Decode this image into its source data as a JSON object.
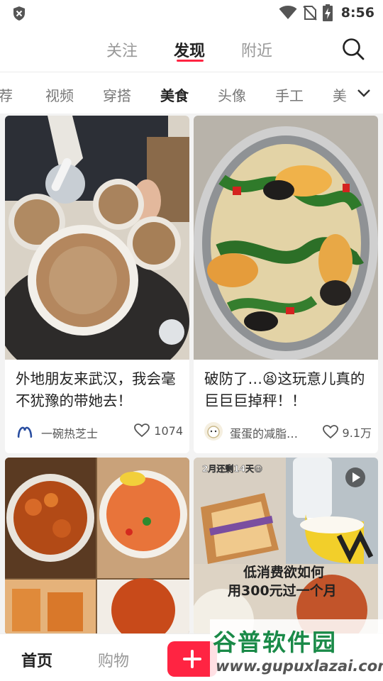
{
  "status_bar": {
    "time": "8:56",
    "icons": [
      "shield-icon",
      "wifi-icon",
      "no-sim-icon",
      "battery-charging-icon"
    ]
  },
  "top_nav": {
    "tabs": [
      {
        "label": "关注",
        "active": false
      },
      {
        "label": "发现",
        "active": true
      },
      {
        "label": "附近",
        "active": false
      }
    ],
    "search_icon": "search-icon",
    "accent_color": "#ff2442"
  },
  "categories": {
    "items": [
      "荐",
      "视频",
      "穿搭",
      "美食",
      "头像",
      "手工",
      "美"
    ],
    "selected": "美食",
    "more_icon": "chevron-down-icon"
  },
  "feed": {
    "cards": [
      {
        "title": "外地朋友来武汉，我会毫不犹豫的带她去！",
        "author": "一碗热芝士",
        "likes": "1074"
      },
      {
        "title": "破防了…😫这玩意儿真的巨巨巨掉秤！！",
        "author": "蛋蛋的减脂…",
        "likes": "9.1万"
      },
      {
        "image_desc": "food collage"
      },
      {
        "image_text_top": "2月还剩14天😃",
        "image_text_line1": "低消费欲如何",
        "image_text_line2": "用300元过一个月"
      }
    ]
  },
  "bottom_nav": {
    "items": [
      {
        "label": "首页",
        "active": true
      },
      {
        "label": "购物",
        "active": false
      }
    ],
    "add_icon": "plus-icon"
  },
  "watermark": {
    "logo": "谷普软件园",
    "url": "www.gupuxlazai.com"
  }
}
